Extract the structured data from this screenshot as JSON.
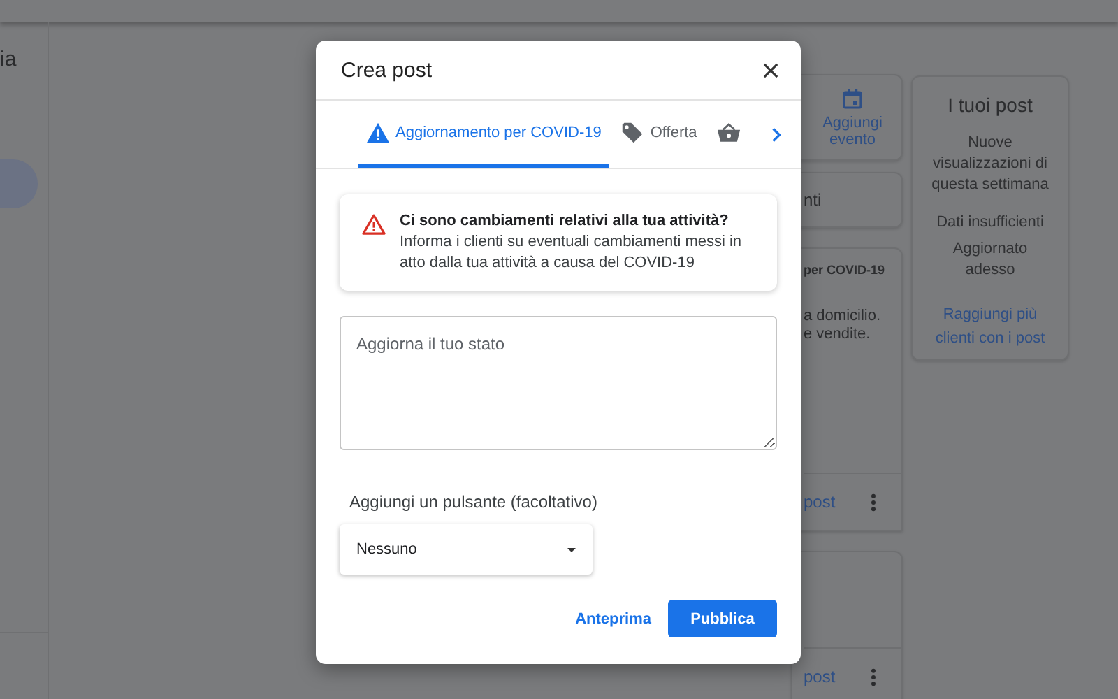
{
  "background": {
    "sidebar": {
      "heading": "ia"
    },
    "action_card": {
      "label": "Aggiungi evento"
    },
    "cards": [
      {
        "text": "nti"
      },
      {
        "tag": "per COVID-19",
        "lines": [
          "a domicilio.",
          "e vendite."
        ],
        "link": "post"
      },
      {
        "link": "post"
      }
    ],
    "stats": {
      "title": "I tuoi post",
      "metric": "Nuove visualizzazioni di questa settimana",
      "value": "Dati insufficienti",
      "updated": "Aggiornato adesso",
      "link": "Raggiungi più clienti con i post"
    }
  },
  "dialog": {
    "title": "Crea post",
    "tabs": [
      {
        "kind": "covid",
        "label": "Aggiornamento per COVID-19",
        "selected": true
      },
      {
        "kind": "offer",
        "label": "Offerta",
        "selected": false
      },
      {
        "kind": "product",
        "selected": false
      }
    ],
    "notice": {
      "title": "Ci sono cambiamenti relativi alla tua attività?",
      "body": "Informa i clienti su eventuali cambiamenti messi in atto dalla tua attività a causa del COVID-19"
    },
    "status": {
      "placeholder": "Aggiorna il tuo stato"
    },
    "button_label": "Aggiungi un pulsante (facoltativo)",
    "button_select": {
      "value": "Nessuno"
    },
    "actions": {
      "preview": "Anteprima",
      "publish": "Pubblica"
    }
  }
}
